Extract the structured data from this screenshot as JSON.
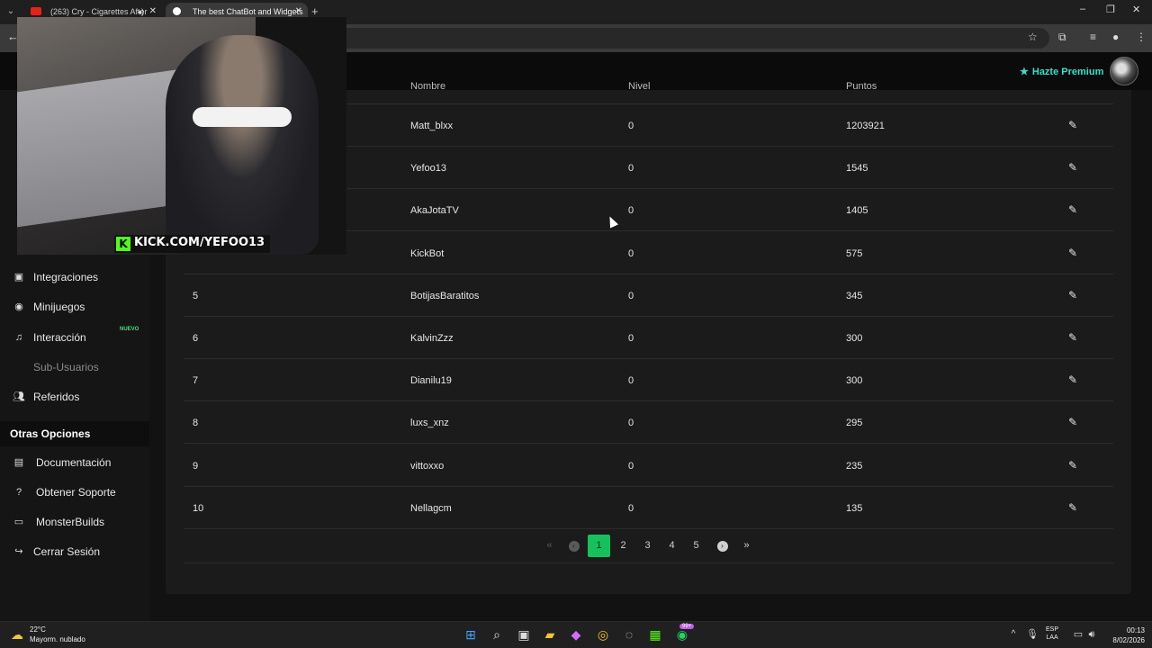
{
  "browser": {
    "tabs": [
      {
        "title": "(263) Cry - Cigarettes After",
        "favicon_color": "#e62117"
      },
      {
        "title": "The best ChatBot and Widgets",
        "favicon_color": "#ffffff"
      }
    ]
  },
  "header": {
    "premium_label": "Hazte Premium"
  },
  "sidebar": {
    "items": [
      {
        "label": "Integraciones",
        "icon": "message-square-icon"
      },
      {
        "label": "Minijuegos",
        "icon": "gamepad-icon"
      },
      {
        "label": "Interacción",
        "icon": "music-note-icon",
        "badge": "NUEVO"
      },
      {
        "label": "Sub-Usuarios",
        "icon": "users-icon"
      },
      {
        "label": "Referidos",
        "icon": "user-group-icon"
      }
    ],
    "section_title": "Otras Opciones",
    "other_options": [
      {
        "label": "Documentación",
        "icon": "book-icon"
      },
      {
        "label": "Obtener Soporte",
        "icon": "help-circle-icon"
      },
      {
        "label": "MonsterBuilds",
        "icon": "laptop-icon"
      },
      {
        "label": "Cerrar Sesión",
        "icon": "sign-out-icon"
      }
    ]
  },
  "table": {
    "columns": [
      "Nombre",
      "Nivel",
      "Puntos"
    ],
    "rows": [
      {
        "pos": "",
        "name": "Matt_blxx",
        "level": "0",
        "points": "1203921"
      },
      {
        "pos": "",
        "name": "Yefoo13",
        "level": "0",
        "points": "1545"
      },
      {
        "pos": "",
        "name": "AkaJotaTV",
        "level": "0",
        "points": "1405"
      },
      {
        "pos": "",
        "name": "KickBot",
        "level": "0",
        "points": "575"
      },
      {
        "pos": "5",
        "name": "BotijasBaratitos",
        "level": "0",
        "points": "345"
      },
      {
        "pos": "6",
        "name": "KalvinZzz",
        "level": "0",
        "points": "300"
      },
      {
        "pos": "7",
        "name": "Dianilu19",
        "level": "0",
        "points": "300"
      },
      {
        "pos": "8",
        "name": "luxs_xnz",
        "level": "0",
        "points": "295"
      },
      {
        "pos": "9",
        "name": "vittoxxo",
        "level": "0",
        "points": "235"
      },
      {
        "pos": "10",
        "name": "Nellagcm",
        "level": "0",
        "points": "135"
      }
    ]
  },
  "pagination": {
    "first": "«",
    "prev": "‹",
    "pages": [
      "1",
      "2",
      "3",
      "4",
      "5"
    ],
    "current": "1",
    "next": "›",
    "last": "»"
  },
  "overlay": {
    "kick_channel": "KICK.COM/YEFOO13"
  },
  "taskbar": {
    "temperature": "22°C",
    "weather": "Mayorm. nublado",
    "language_top": "ESP",
    "language_bottom": "LAA",
    "time": "00:13",
    "date": "8/02/2026",
    "whatsapp_badge": "99+"
  }
}
